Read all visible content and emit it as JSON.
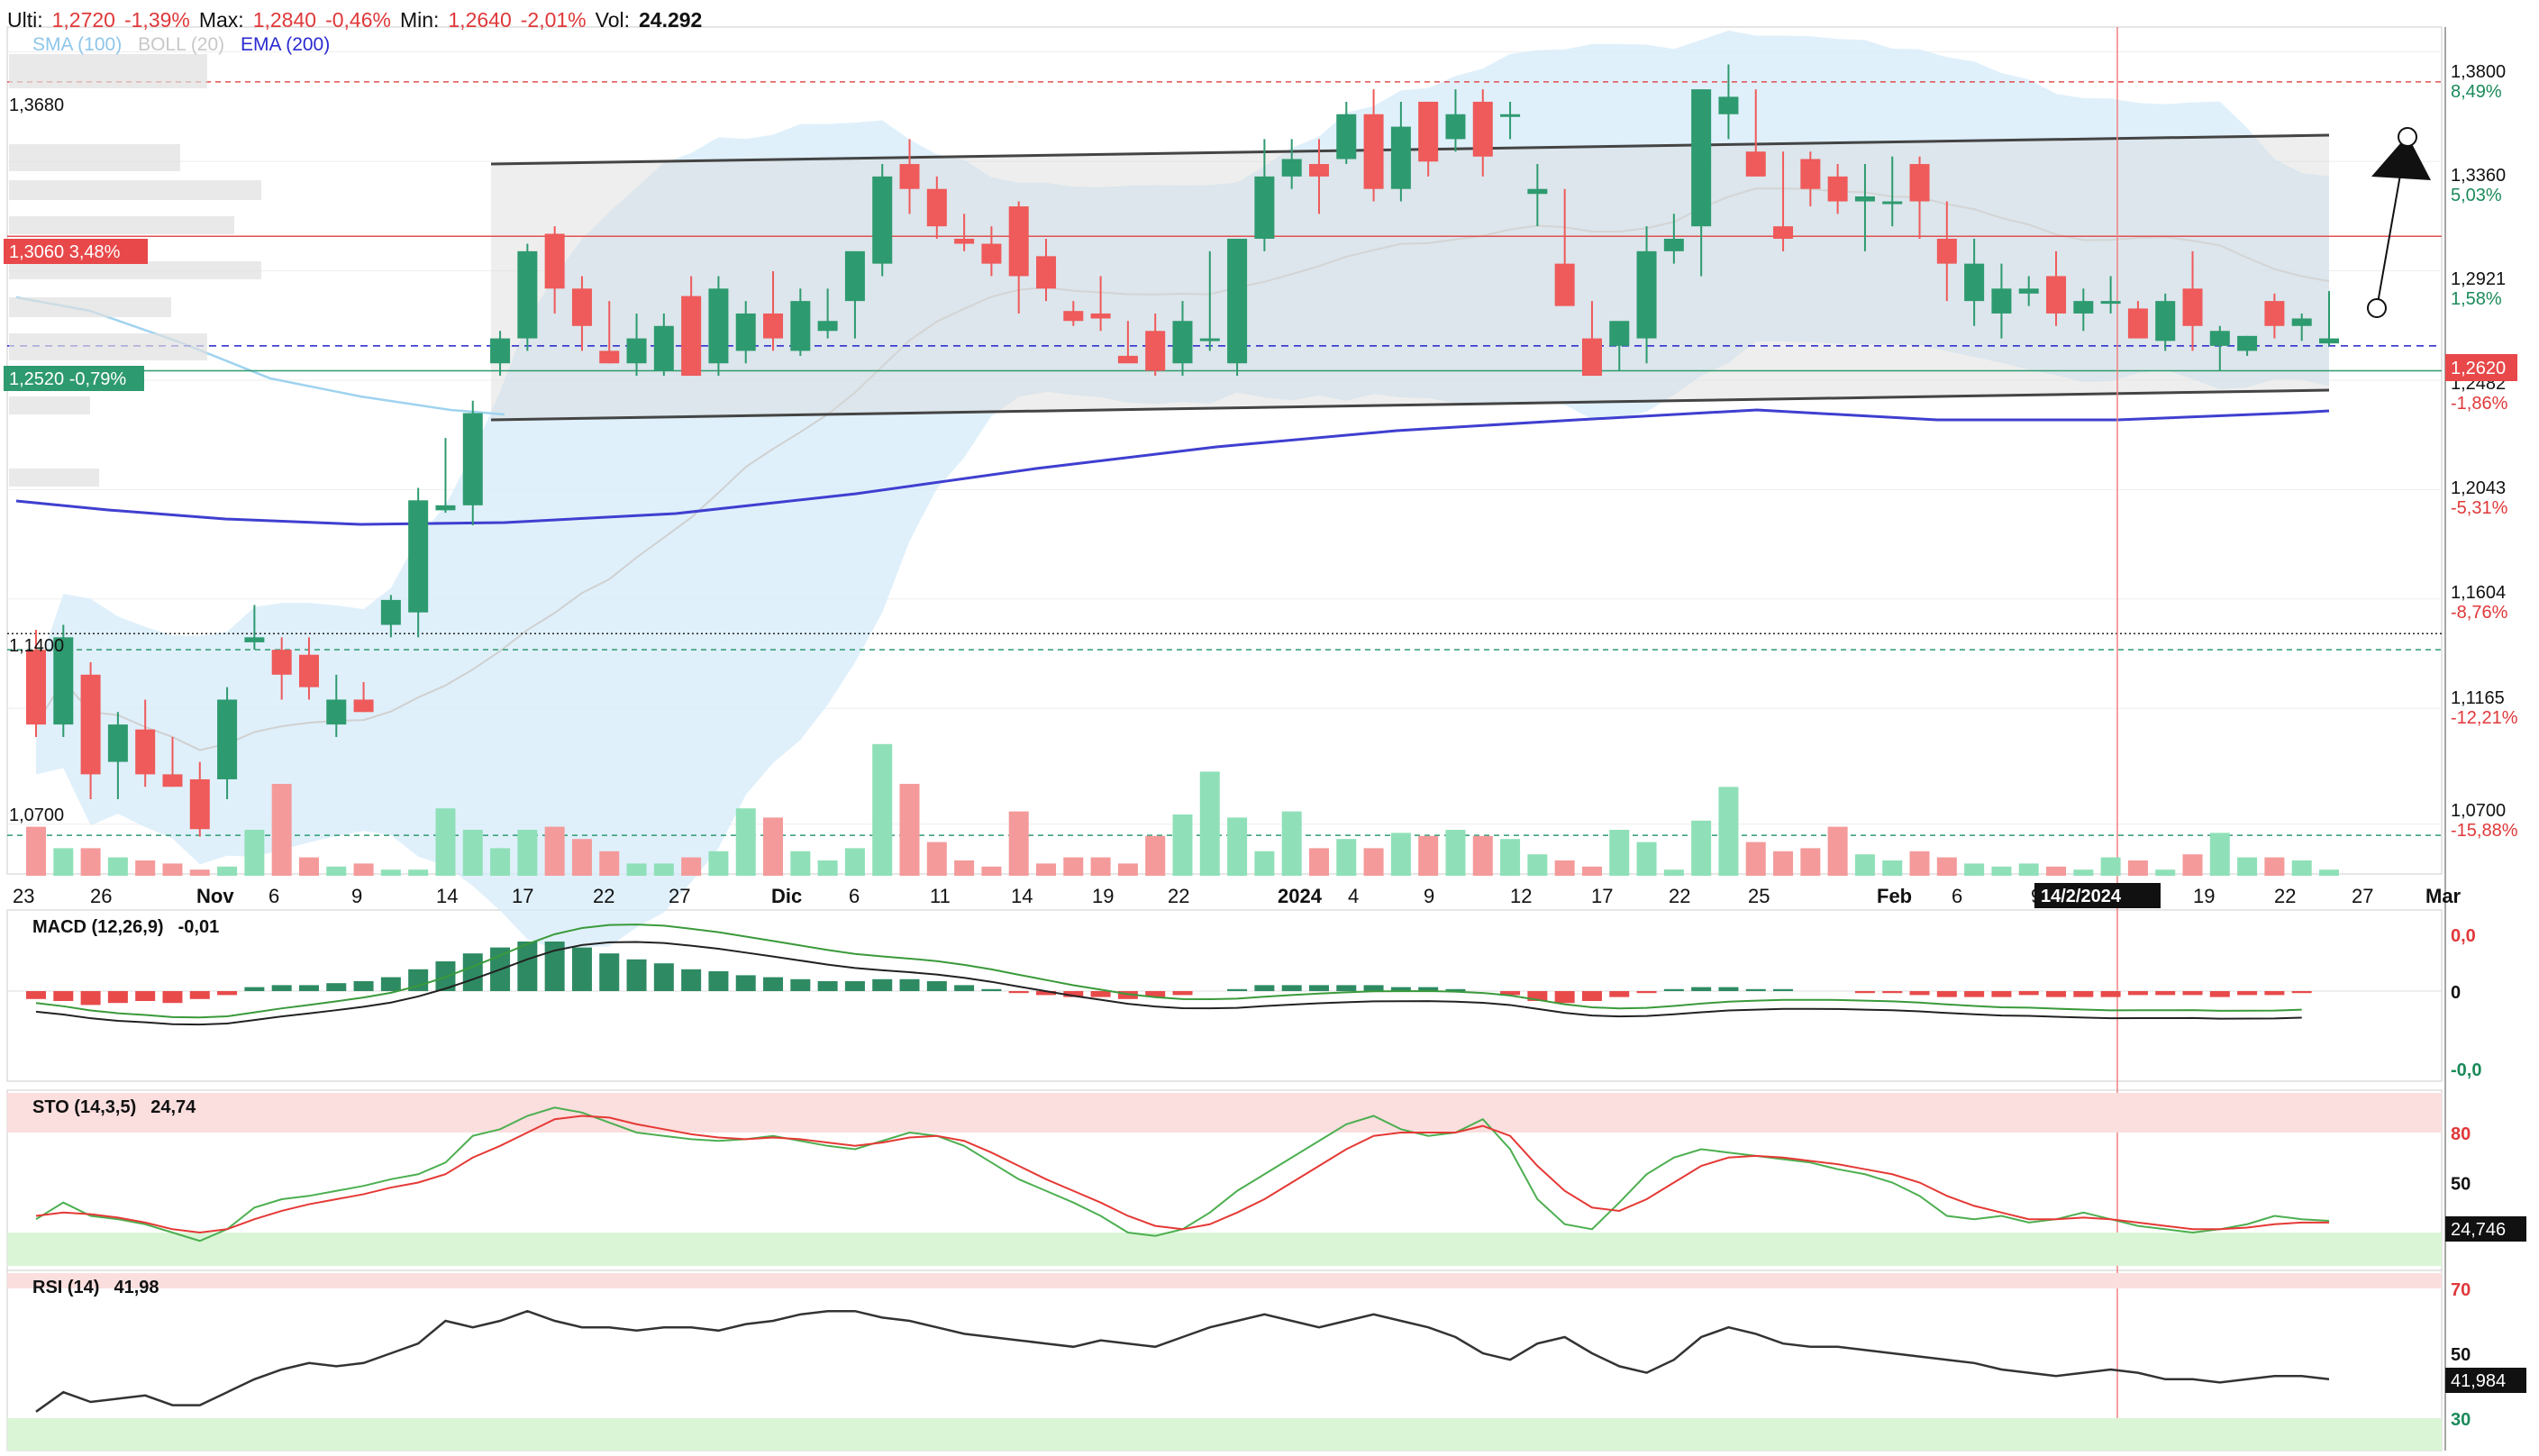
{
  "header": {
    "last_label": "Ulti:",
    "last_value": "1,2720",
    "last_change": "-1,39%",
    "max_label": "Max:",
    "max_value": "1,2840",
    "max_change": "-0,46%",
    "min_label": "Min:",
    "min_value": "1,2640",
    "min_change": "-2,01%",
    "vol_label": "Vol:",
    "vol_value": "24.292"
  },
  "indicators_legend": {
    "sma": "SMA (100)",
    "boll": "BOLL (20)",
    "ema": "EMA (200)"
  },
  "colors": {
    "up": "#2e9a6f",
    "down": "#ef5a5a",
    "ema": "#3f3fd0",
    "sma": "#9fd3ef",
    "boll_fill": "#d4ebf9",
    "channel": "#444444",
    "accent_red": "#e0383a"
  },
  "price_axis": {
    "ticks": [
      {
        "value": "1,3800",
        "pct": "8,49%",
        "sign": "pos"
      },
      {
        "value": "1,3360",
        "pct": "5,03%",
        "sign": "pos"
      },
      {
        "value": "1,2921",
        "pct": "1,58%",
        "sign": "pos"
      },
      {
        "value": "1,2482",
        "pct": "-1,86%",
        "sign": "neg"
      },
      {
        "value": "1,2043",
        "pct": "-5,31%",
        "sign": "neg"
      },
      {
        "value": "1,1604",
        "pct": "-8,76%",
        "sign": "neg"
      },
      {
        "value": "1,1165",
        "pct": "-12,21%",
        "sign": "neg"
      },
      {
        "value": "1,0700",
        "pct": "-15,88%",
        "sign": "neg"
      }
    ],
    "current_price_tag": "1,2620"
  },
  "level_labels": {
    "l1368": "1,3680",
    "l1306": "1,3060",
    "l1306_pct": "3,48%",
    "l1252": "1,2520",
    "l1252_pct": "-0,79%",
    "l1140": "1,1400",
    "l1070": "1,0700"
  },
  "date_axis": {
    "labels": [
      "23",
      "26",
      "Nov",
      "6",
      "9",
      "14",
      "17",
      "22",
      "27",
      "Dic",
      "6",
      "11",
      "14",
      "19",
      "22",
      "2024",
      "4",
      "9",
      "12",
      "17",
      "22",
      "25",
      "Feb",
      "6",
      "9",
      "19",
      "22",
      "27",
      "Mar"
    ],
    "crosshair_date": "14/2/2024"
  },
  "macd": {
    "label": "MACD (12,26,9)",
    "value": "-0,01",
    "axis": [
      "0,0",
      "0",
      "-0,0"
    ]
  },
  "sto": {
    "label": "STO (14,3,5)",
    "value": "24,74",
    "axis": [
      "80",
      "50"
    ],
    "tag": "24,746"
  },
  "rsi": {
    "label": "RSI (14)",
    "value": "41,98",
    "axis": [
      "70",
      "50",
      "30"
    ],
    "tag": "41,984"
  },
  "chart_data": {
    "type": "candlestick",
    "title": "",
    "ylim": [
      1.05,
      1.39
    ],
    "candles": [
      [
        1.14,
        1.148,
        1.105,
        1.11
      ],
      [
        1.11,
        1.15,
        1.105,
        1.145
      ],
      [
        1.13,
        1.135,
        1.08,
        1.09
      ],
      [
        1.095,
        1.115,
        1.08,
        1.11
      ],
      [
        1.108,
        1.12,
        1.085,
        1.09
      ],
      [
        1.09,
        1.105,
        1.085,
        1.085
      ],
      [
        1.088,
        1.095,
        1.065,
        1.068
      ],
      [
        1.088,
        1.125,
        1.08,
        1.12
      ],
      [
        1.143,
        1.158,
        1.14,
        1.145
      ],
      [
        1.14,
        1.145,
        1.12,
        1.13
      ],
      [
        1.138,
        1.145,
        1.12,
        1.125
      ],
      [
        1.11,
        1.13,
        1.105,
        1.12
      ],
      [
        1.12,
        1.127,
        1.115,
        1.115
      ],
      [
        1.15,
        1.162,
        1.145,
        1.16
      ],
      [
        1.155,
        1.205,
        1.145,
        1.2
      ],
      [
        1.196,
        1.225,
        1.195,
        1.198
      ],
      [
        1.198,
        1.24,
        1.19,
        1.235
      ],
      [
        1.255,
        1.268,
        1.25,
        1.265
      ],
      [
        1.265,
        1.303,
        1.26,
        1.3
      ],
      [
        1.307,
        1.31,
        1.275,
        1.285
      ],
      [
        1.285,
        1.29,
        1.26,
        1.27
      ],
      [
        1.26,
        1.28,
        1.255,
        1.255
      ],
      [
        1.255,
        1.275,
        1.25,
        1.265
      ],
      [
        1.252,
        1.275,
        1.25,
        1.27
      ],
      [
        1.282,
        1.29,
        1.25,
        1.25
      ],
      [
        1.255,
        1.29,
        1.25,
        1.285
      ],
      [
        1.26,
        1.28,
        1.255,
        1.275
      ],
      [
        1.275,
        1.292,
        1.26,
        1.265
      ],
      [
        1.26,
        1.285,
        1.258,
        1.28
      ],
      [
        1.268,
        1.285,
        1.265,
        1.272
      ],
      [
        1.28,
        1.3,
        1.265,
        1.3
      ],
      [
        1.295,
        1.335,
        1.29,
        1.33
      ],
      [
        1.335,
        1.345,
        1.315,
        1.325
      ],
      [
        1.325,
        1.33,
        1.305,
        1.31
      ],
      [
        1.305,
        1.315,
        1.3,
        1.303
      ],
      [
        1.303,
        1.31,
        1.29,
        1.295
      ],
      [
        1.318,
        1.32,
        1.275,
        1.29
      ],
      [
        1.298,
        1.305,
        1.28,
        1.285
      ],
      [
        1.276,
        1.28,
        1.27,
        1.272
      ],
      [
        1.275,
        1.29,
        1.268,
        1.273
      ],
      [
        1.258,
        1.272,
        1.255,
        1.255
      ],
      [
        1.268,
        1.275,
        1.25,
        1.252
      ],
      [
        1.255,
        1.28,
        1.25,
        1.272
      ],
      [
        1.265,
        1.3,
        1.26,
        1.265
      ],
      [
        1.255,
        1.305,
        1.25,
        1.305
      ],
      [
        1.305,
        1.345,
        1.3,
        1.33
      ],
      [
        1.33,
        1.345,
        1.325,
        1.337
      ],
      [
        1.335,
        1.345,
        1.315,
        1.33
      ],
      [
        1.337,
        1.36,
        1.335,
        1.355
      ],
      [
        1.355,
        1.365,
        1.32,
        1.325
      ],
      [
        1.325,
        1.36,
        1.32,
        1.35
      ],
      [
        1.36,
        1.36,
        1.33,
        1.336
      ],
      [
        1.345,
        1.365,
        1.34,
        1.355
      ],
      [
        1.36,
        1.365,
        1.33,
        1.338
      ],
      [
        1.355,
        1.36,
        1.345,
        1.355
      ],
      [
        1.323,
        1.335,
        1.31,
        1.325
      ],
      [
        1.295,
        1.325,
        1.29,
        1.278
      ],
      [
        1.265,
        1.28,
        1.25,
        1.25
      ],
      [
        1.262,
        1.27,
        1.252,
        1.272
      ],
      [
        1.265,
        1.31,
        1.255,
        1.3
      ],
      [
        1.3,
        1.315,
        1.295,
        1.305
      ],
      [
        1.31,
        1.365,
        1.29,
        1.365
      ],
      [
        1.355,
        1.375,
        1.345,
        1.362
      ],
      [
        1.34,
        1.365,
        1.33,
        1.33
      ],
      [
        1.31,
        1.34,
        1.3,
        1.305
      ],
      [
        1.337,
        1.34,
        1.318,
        1.325
      ],
      [
        1.33,
        1.335,
        1.315,
        1.32
      ],
      [
        1.32,
        1.335,
        1.3,
        1.322
      ],
      [
        1.32,
        1.338,
        1.31,
        1.32
      ],
      [
        1.335,
        1.338,
        1.305,
        1.32
      ],
      [
        1.305,
        1.32,
        1.28,
        1.295
      ],
      [
        1.28,
        1.305,
        1.27,
        1.295
      ],
      [
        1.275,
        1.295,
        1.265,
        1.285
      ],
      [
        1.283,
        1.29,
        1.278,
        1.285
      ],
      [
        1.29,
        1.3,
        1.27,
        1.275
      ],
      [
        1.275,
        1.285,
        1.268,
        1.28
      ],
      [
        1.28,
        1.29,
        1.275,
        1.28
      ],
      [
        1.277,
        1.28,
        1.265,
        1.265
      ],
      [
        1.264,
        1.283,
        1.26,
        1.28
      ],
      [
        1.285,
        1.3,
        1.26,
        1.27
      ],
      [
        1.262,
        1.27,
        1.252,
        1.268
      ],
      [
        1.26,
        1.266,
        1.258,
        1.266
      ],
      [
        1.28,
        1.283,
        1.265,
        1.27
      ],
      [
        1.27,
        1.275,
        1.264,
        1.273
      ],
      [
        1.263,
        1.284,
        1.262,
        1.265
      ]
    ],
    "volume": [
      16,
      9,
      9,
      6,
      5,
      4,
      2,
      3,
      15,
      30,
      6,
      3,
      4,
      2,
      2,
      22,
      15,
      9,
      15,
      16,
      12,
      8,
      4,
      4,
      6,
      8,
      22,
      19,
      8,
      5,
      9,
      43,
      30,
      11,
      5,
      3,
      21,
      4,
      6,
      6,
      4,
      13,
      20,
      34,
      19,
      8,
      21,
      9,
      12,
      9,
      14,
      13,
      15,
      13,
      12,
      7,
      5,
      3,
      15,
      11,
      2,
      18,
      29,
      11,
      8,
      9,
      16,
      7,
      5,
      8,
      6,
      4,
      3,
      4,
      3,
      2,
      6,
      5,
      2,
      7,
      14,
      6,
      6,
      5,
      2
    ],
    "macd_hist": [
      -0.4,
      -0.5,
      -0.7,
      -0.6,
      -0.5,
      -0.6,
      -0.4,
      -0.2,
      0.2,
      0.3,
      0.3,
      0.4,
      0.5,
      0.7,
      1.1,
      1.5,
      1.9,
      2.2,
      2.5,
      2.5,
      2.2,
      1.9,
      1.6,
      1.4,
      1.1,
      1.0,
      0.8,
      0.7,
      0.6,
      0.5,
      0.5,
      0.6,
      0.6,
      0.5,
      0.3,
      0.1,
      -0.1,
      -0.2,
      -0.3,
      -0.3,
      -0.4,
      -0.3,
      -0.2,
      0.0,
      0.1,
      0.3,
      0.3,
      0.3,
      0.3,
      0.3,
      0.2,
      0.2,
      0.1,
      0.0,
      -0.2,
      -0.5,
      -0.6,
      -0.5,
      -0.3,
      -0.1,
      0.1,
      0.2,
      0.2,
      0.1,
      0.1,
      0.0,
      0.0,
      -0.1,
      -0.1,
      -0.2,
      -0.3,
      -0.3,
      -0.3,
      -0.2,
      -0.3,
      -0.3,
      -0.3,
      -0.2,
      -0.2,
      -0.2,
      -0.3,
      -0.2,
      -0.2,
      -0.1
    ],
    "sto_k": [
      28,
      38,
      30,
      28,
      25,
      20,
      15,
      22,
      35,
      40,
      42,
      45,
      48,
      52,
      55,
      62,
      78,
      82,
      90,
      95,
      92,
      86,
      80,
      78,
      76,
      75,
      76,
      78,
      75,
      72,
      70,
      75,
      80,
      78,
      72,
      62,
      52,
      45,
      38,
      30,
      20,
      18,
      22,
      32,
      45,
      55,
      65,
      75,
      85,
      90,
      82,
      78,
      80,
      88,
      70,
      40,
      25,
      22,
      38,
      55,
      65,
      70,
      68,
      66,
      64,
      62,
      58,
      55,
      50,
      42,
      30,
      28,
      30,
      26,
      28,
      32,
      28,
      24,
      22,
      20,
      22,
      25,
      30,
      28,
      27
    ],
    "sto_d": [
      30,
      32,
      31,
      29,
      26,
      22,
      20,
      22,
      28,
      33,
      37,
      40,
      43,
      47,
      50,
      55,
      65,
      72,
      80,
      88,
      90,
      89,
      85,
      82,
      79,
      77,
      76,
      77,
      76,
      74,
      72,
      74,
      77,
      78,
      75,
      68,
      60,
      52,
      45,
      38,
      30,
      24,
      22,
      25,
      32,
      40,
      50,
      60,
      70,
      78,
      80,
      80,
      80,
      84,
      78,
      60,
      45,
      35,
      33,
      40,
      50,
      60,
      65,
      66,
      65,
      63,
      61,
      58,
      55,
      50,
      42,
      36,
      32,
      28,
      28,
      29,
      28,
      26,
      24,
      22,
      22,
      23,
      25,
      26,
      26
    ],
    "rsi": [
      32,
      38,
      35,
      36,
      37,
      34,
      34,
      38,
      42,
      45,
      47,
      46,
      47,
      50,
      53,
      60,
      58,
      60,
      63,
      60,
      58,
      58,
      57,
      58,
      58,
      57,
      59,
      60,
      62,
      63,
      63,
      61,
      60,
      58,
      56,
      55,
      54,
      53,
      52,
      54,
      53,
      52,
      55,
      58,
      60,
      62,
      60,
      58,
      60,
      62,
      60,
      58,
      55,
      50,
      48,
      53,
      55,
      50,
      46,
      44,
      48,
      55,
      58,
      56,
      53,
      52,
      52,
      51,
      50,
      49,
      48,
      47,
      45,
      44,
      43,
      44,
      45,
      44,
      42,
      42,
      41,
      42,
      43,
      43,
      42
    ]
  }
}
